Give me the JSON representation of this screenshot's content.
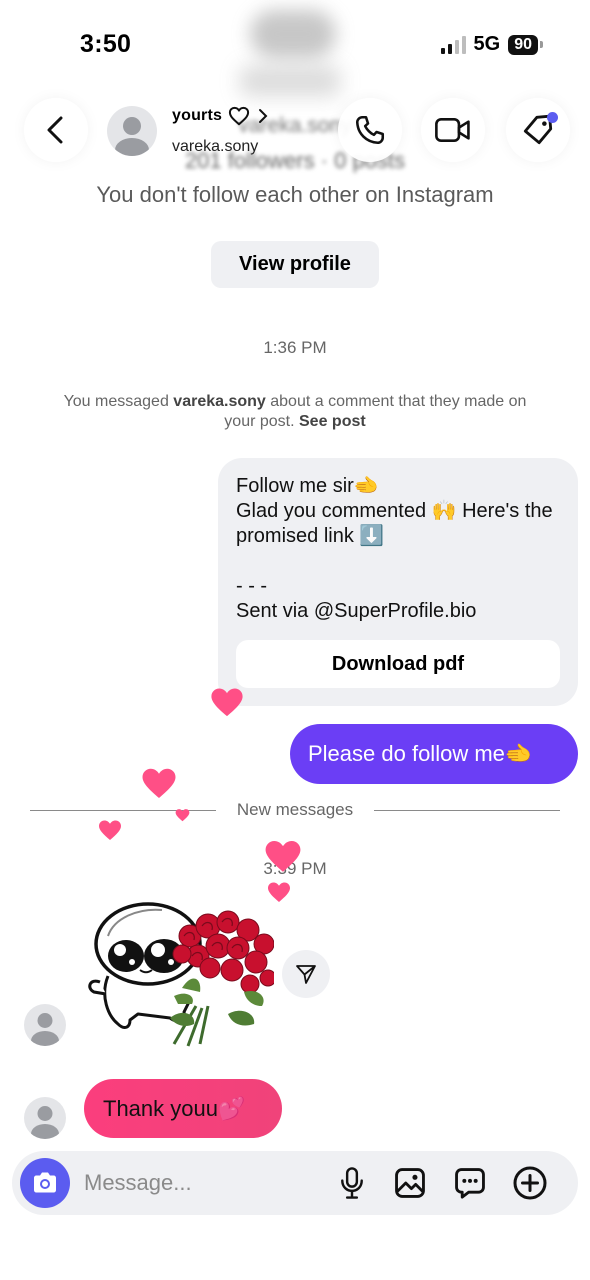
{
  "status_bar": {
    "time": "3:50",
    "network": "5G",
    "battery": "90"
  },
  "profile_card": {
    "username": "vareka.sony",
    "stats": "201 followers · 0 posts",
    "follow_note": "You don't follow each other on Instagram",
    "view_profile_label": "View profile"
  },
  "header": {
    "display_name": "yourts",
    "username": "vareka.sony"
  },
  "conversation": {
    "timestamp_1": "1:36 PM",
    "system_note": {
      "prefix": "You messaged ",
      "user": "vareka.sony",
      "middle": " about a comment that they made on your post. ",
      "link": "See post"
    },
    "outgoing_card": {
      "text": "Follow me sir🫲\nGlad you commented 🙌 Here's the promised link ⬇️\n\n- - -\nSent via @SuperProfile.bio",
      "button_label": "Download pdf"
    },
    "outgoing_message": "Please do follow me🫲",
    "new_messages_label": "New messages",
    "timestamp_2": "3:39 PM",
    "incoming_message": "Thank youu💕"
  },
  "composer": {
    "placeholder": "Message..."
  },
  "icons": {
    "back": "chevron-left-icon",
    "heart": "heart-outline-icon",
    "chevron": "chevron-right-icon",
    "call": "phone-icon",
    "video": "video-camera-icon",
    "tag": "tag-icon",
    "send": "paper-plane-icon",
    "camera": "camera-icon",
    "mic": "microphone-icon",
    "gallery": "image-icon",
    "sticker": "sticker-icon",
    "plus": "plus-circle-icon"
  },
  "colors": {
    "accent": "#5b5cf0",
    "outgoing_bubble": "#6b3ef5",
    "incoming_bubble": "#fb3e7d",
    "card_bg": "#eff0f3",
    "heart": "#ff4f86"
  }
}
